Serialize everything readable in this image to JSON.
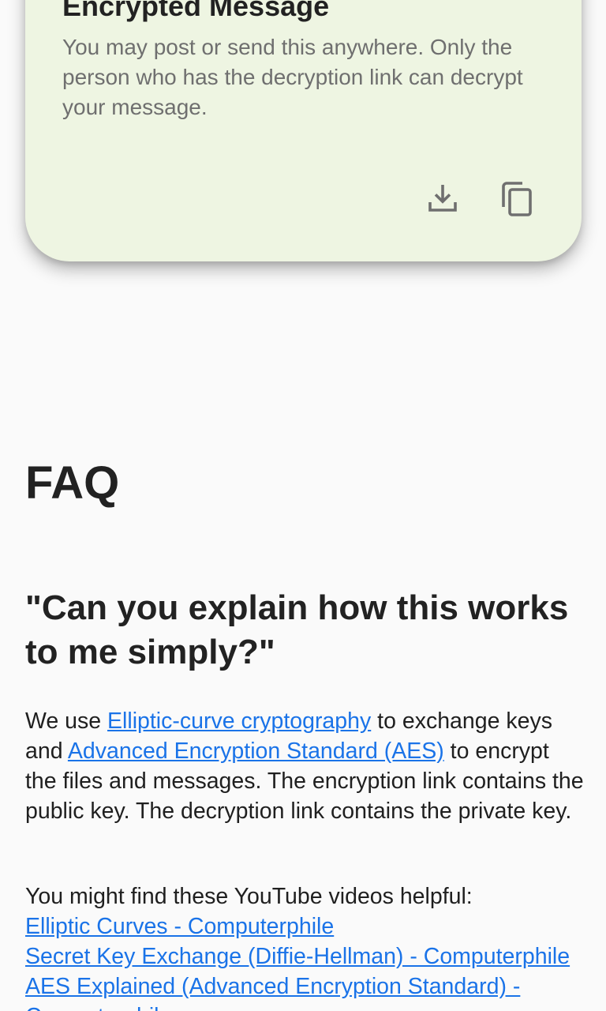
{
  "card": {
    "title": "Encrypted Message",
    "description": "You may post or send this anywhere. Only the person who has the decryption link can decrypt your message.",
    "icons": {
      "download": "download-icon",
      "copy": "copy-icon"
    },
    "colors": {
      "background": "#eef5e2",
      "icon": "#6f6f6f"
    }
  },
  "faq": {
    "heading": "FAQ",
    "question": "\"Can you explain how this works to me simply?\"",
    "answer": {
      "text1": "We use ",
      "link1": "Elliptic-curve cryptography",
      "text2": " to exchange keys and ",
      "link2": "Advanced Encryption Standard (AES)",
      "text3": " to encrypt the files and messages. The encryption link contains the public key. The decryption link contains the private key."
    },
    "videos_intro": "You might find these YouTube videos helpful:",
    "video_links": [
      "Elliptic Curves - Computerphile",
      "Secret Key Exchange (Diffie-Hellman) - Computerphile",
      "AES Explained (Advanced Encryption Standard) - Computerphile"
    ]
  },
  "colors": {
    "page_background": "#fafafa",
    "link": "#1a73e8",
    "text": "#1f1f1f"
  }
}
